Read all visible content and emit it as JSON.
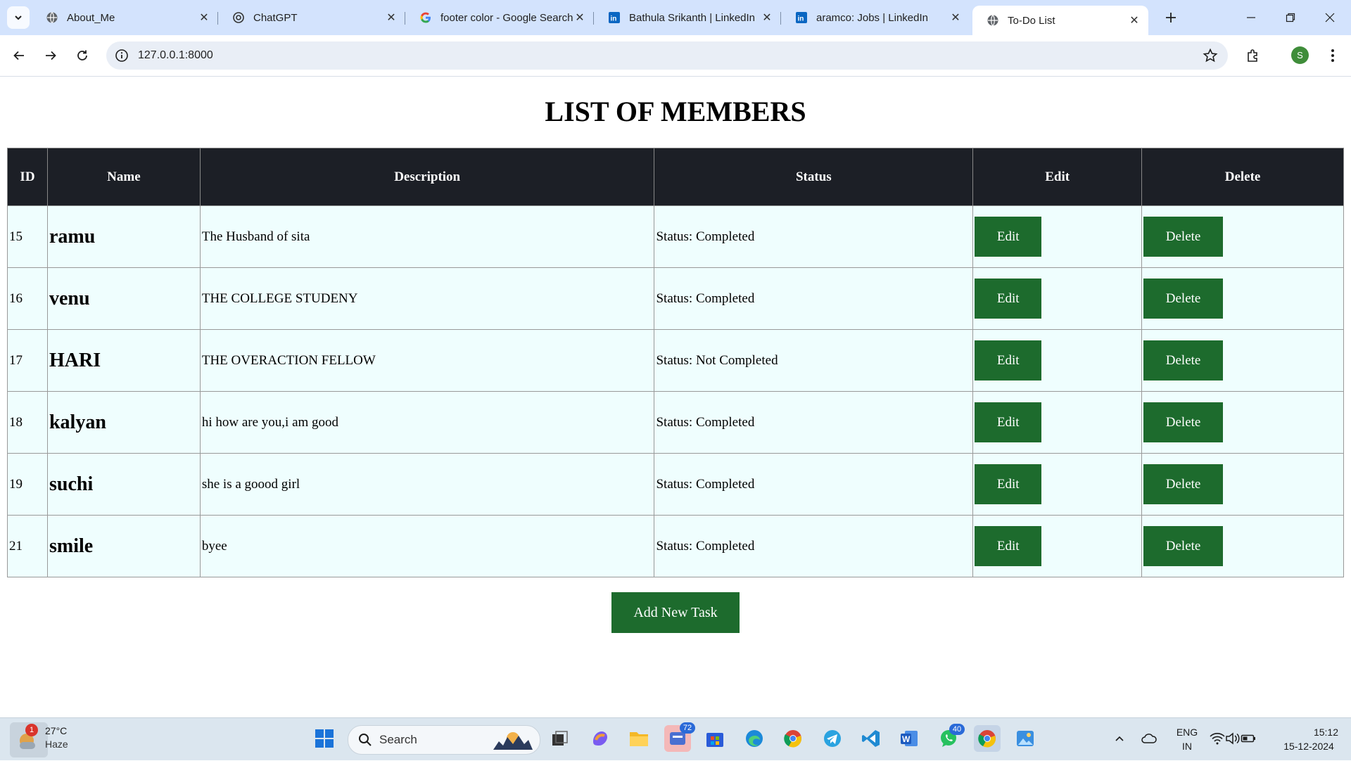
{
  "browser": {
    "tabs": [
      {
        "title": "About_Me",
        "icon": "globe-icon"
      },
      {
        "title": "ChatGPT",
        "icon": "chatgpt-icon"
      },
      {
        "title": "footer color - Google Search",
        "icon": "google-icon"
      },
      {
        "title": "Bathula Srikanth | LinkedIn",
        "icon": "linkedin-icon"
      },
      {
        "title": "aramco: Jobs | LinkedIn",
        "icon": "linkedin-icon"
      },
      {
        "title": "To-Do List",
        "icon": "globe-icon",
        "active": true
      }
    ],
    "url": "127.0.0.1:8000",
    "profile_initial": "S"
  },
  "page": {
    "heading": "LIST OF MEMBERS",
    "columns": [
      "ID",
      "Name",
      "Description",
      "Status",
      "Edit",
      "Delete"
    ],
    "rows": [
      {
        "id": "15",
        "name": "ramu",
        "description": "The Husband of sita",
        "status": "Status: Completed"
      },
      {
        "id": "16",
        "name": "venu",
        "description": "THE COLLEGE STUDENY",
        "status": "Status: Completed"
      },
      {
        "id": "17",
        "name": "HARI",
        "description": "THE OVERACTION FELLOW",
        "status": "Status: Not Completed"
      },
      {
        "id": "18",
        "name": "kalyan",
        "description": "hi how are you,i am good",
        "status": "Status: Completed"
      },
      {
        "id": "19",
        "name": "suchi",
        "description": "she is a goood girl",
        "status": "Status: Completed"
      },
      {
        "id": "21",
        "name": "smile",
        "description": "byee",
        "status": "Status: Completed"
      }
    ],
    "edit_label": "Edit",
    "delete_label": "Delete",
    "add_label": "Add New Task",
    "button_color": "#1d6b2d",
    "header_color": "#1c1f26",
    "row_color": "#effefe"
  },
  "taskbar": {
    "weather_temp": "27°C",
    "weather_desc": "Haze",
    "weather_badge": "1",
    "search_placeholder": "Search",
    "teams_badge": "72",
    "whatsapp_badge": "40",
    "lang_line1": "ENG",
    "lang_line2": "IN",
    "time": "15:12",
    "date": "15-12-2024"
  }
}
